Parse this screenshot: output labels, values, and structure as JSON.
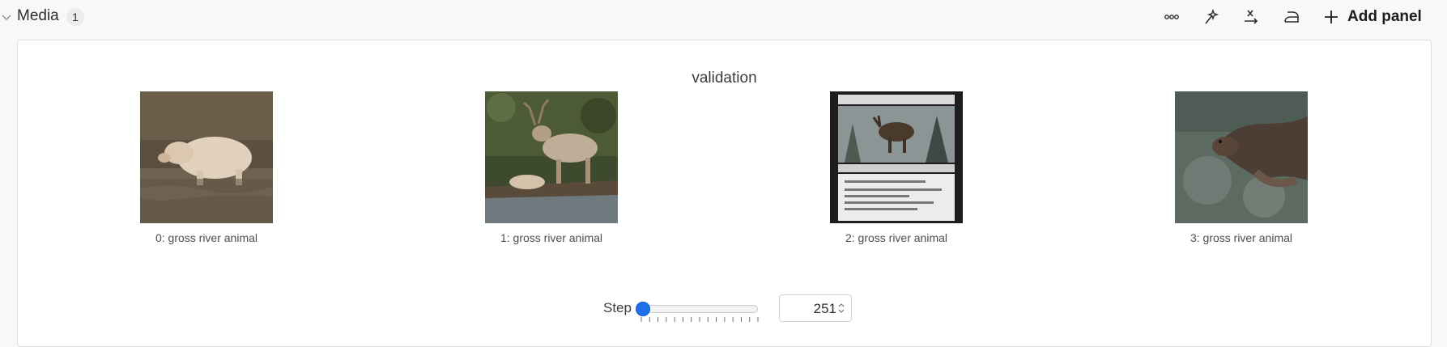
{
  "section": {
    "title": "Media",
    "count": "1"
  },
  "toolbar": {
    "icons": [
      "more-options-icon",
      "magic-wand-icon",
      "x-variable-icon",
      "iron-icon"
    ],
    "add_panel_label": "Add panel"
  },
  "panel": {
    "title": "validation",
    "items": [
      {
        "caption": "0: gross river animal",
        "image": "pale pig wading in river"
      },
      {
        "caption": "1: gross river animal",
        "image": "deer on riverbank"
      },
      {
        "caption": "2: gross river animal",
        "image": "trading card with moose"
      },
      {
        "caption": "3: gross river animal",
        "image": "otter splashing in water"
      }
    ],
    "step": {
      "label": "Step",
      "value": "251",
      "slider_position": 0.0
    }
  },
  "colors": {
    "accent": "#1f6feb",
    "background": "#f8f8f8",
    "panel": "#ffffff"
  }
}
